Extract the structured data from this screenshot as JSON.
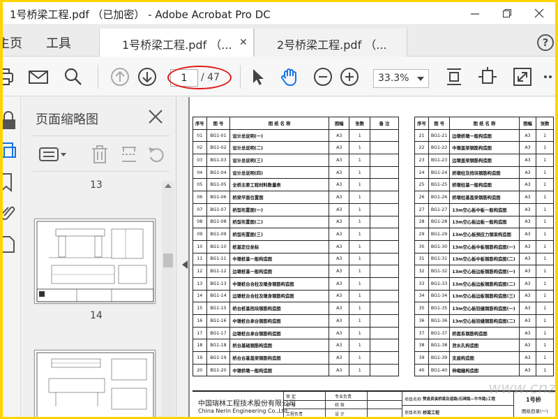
{
  "window": {
    "title": "1号桥梁工程.pdf （已加密） - Adobe Acrobat Pro DC"
  },
  "tabs": {
    "home": "主页",
    "tools": "工具",
    "documents": [
      {
        "label": "1号桥梁工程.pdf （...",
        "active": true
      },
      {
        "label": "2号桥梁工程.pdf （...",
        "active": false
      }
    ],
    "close_glyph": "✕",
    "help": "?"
  },
  "toolbar": {
    "current_page": "1",
    "total_pages": "/ 47",
    "zoom": "33.3%"
  },
  "thumbnail_panel": {
    "title": "页面缩略图",
    "page_numbers": [
      "13",
      "14"
    ]
  },
  "drawing_index": {
    "headers": [
      "序号",
      "图 号",
      "图 纸 名 称",
      "图幅",
      "张数",
      "备 注"
    ],
    "left_rows": [
      [
        "01",
        "BG1-01",
        "设计总说明(一)",
        "A3",
        "1",
        ""
      ],
      [
        "02",
        "BG1-02",
        "设计总说明(二)",
        "A3",
        "1",
        ""
      ],
      [
        "03",
        "BG1-03",
        "设计总说明(三)",
        "A3",
        "1",
        ""
      ],
      [
        "04",
        "BG1-04",
        "设计总说明(四)",
        "A3",
        "1",
        ""
      ],
      [
        "05",
        "BG1-05",
        "全桥主要工程材料数量表",
        "A3",
        "1",
        ""
      ],
      [
        "06",
        "BG1-06",
        "桥梁平面位置图",
        "A3",
        "1",
        ""
      ],
      [
        "07",
        "BG1-07",
        "桥型布置图(一)",
        "A3",
        "1",
        ""
      ],
      [
        "08",
        "BG1-08",
        "桥型布置图(二)",
        "A3",
        "1",
        ""
      ],
      [
        "09",
        "BG1-09",
        "桥型布置图(三)",
        "A3",
        "1",
        ""
      ],
      [
        "10",
        "BG1-10",
        "桩基定位坐标",
        "A3",
        "1",
        ""
      ],
      [
        "11",
        "BG1-11",
        "中墩桩基一般构造图",
        "A3",
        "1",
        ""
      ],
      [
        "12",
        "BG1-12",
        "边墩桩基一般构造图",
        "A3",
        "1",
        ""
      ],
      [
        "13",
        "BG1-13",
        "中墩桩台合柱及墩身钢筋构造图",
        "A3",
        "1",
        ""
      ],
      [
        "14",
        "BG1-14",
        "边墩桩台合柱及墩身钢筋构造图",
        "A3",
        "1",
        ""
      ],
      [
        "15",
        "BG1-15",
        "桥台桩基挡块钢筋构造图",
        "A3",
        "1",
        ""
      ],
      [
        "16",
        "BG1-16",
        "中墩桩台承台钢筋构造图",
        "A3",
        "1",
        ""
      ],
      [
        "17",
        "BG1-17",
        "边墩桩台承台钢筋构造图",
        "A3",
        "1",
        ""
      ],
      [
        "18",
        "BG1-18",
        "桥台基础钢筋构造图",
        "A3",
        "1",
        ""
      ],
      [
        "19",
        "BG1-19",
        "桥台台基盖梁钢筋构造图",
        "A3",
        "1",
        ""
      ],
      [
        "20",
        "BG1-20",
        "中墩桥墩一般构造图",
        "A3",
        "1",
        ""
      ]
    ],
    "right_rows": [
      [
        "21",
        "BG1-21",
        "边墩桥墩一般构造图",
        "A3",
        "1",
        ""
      ],
      [
        "22",
        "BG1-22",
        "中墩盖梁钢筋构造图",
        "A3",
        "1",
        ""
      ],
      [
        "23",
        "BG1-23",
        "边墩盖梁钢筋构造图",
        "A3",
        "1",
        ""
      ],
      [
        "24",
        "BG1-24",
        "桥墩柱及挡块钢筋构造图",
        "A3",
        "1",
        ""
      ],
      [
        "25",
        "BG1-25",
        "桥墩柱基一般构造图",
        "A3",
        "1",
        ""
      ],
      [
        "26",
        "BG1-26",
        "桥墩柱基盖梁钢筋构造图",
        "A3",
        "1",
        ""
      ],
      [
        "27",
        "BG1-27",
        "13m空心板中板一般构造图",
        "A3",
        "1",
        ""
      ],
      [
        "28",
        "BG1-28",
        "13m空心板边板一般构造图",
        "A3",
        "1",
        ""
      ],
      [
        "29",
        "BG1-29",
        "13m空心板预应力钢束构造图",
        "A3",
        "1",
        ""
      ],
      [
        "30",
        "BG1-30",
        "13m空心板中板钢筋构造图(一)",
        "A3",
        "1",
        ""
      ],
      [
        "31",
        "BG1-31",
        "13m空心板中板钢筋构造图(二)",
        "A3",
        "1",
        ""
      ],
      [
        "32",
        "BG1-32",
        "13m空心板边板钢筋构造图(一)",
        "A3",
        "1",
        ""
      ],
      [
        "33",
        "BG1-33",
        "13m空心板边板钢筋构造图(二)",
        "A3",
        "1",
        ""
      ],
      [
        "34",
        "BG1-34",
        "13m空心板边板钢筋构造图(三)",
        "A3",
        "1",
        ""
      ],
      [
        "35",
        "BG1-35",
        "13m空心板铰缝钢筋构造图(一)",
        "A3",
        "1",
        ""
      ],
      [
        "36",
        "BG1-36",
        "13m空心板铰缝钢筋构造图(二)",
        "A3",
        "1",
        ""
      ],
      [
        "37",
        "BG1-37",
        "桥面系钢筋构造图",
        "A3",
        "1",
        ""
      ],
      [
        "38",
        "BG1-38",
        "泄水孔构造图",
        "A3",
        "1",
        ""
      ],
      [
        "39",
        "BG1-39",
        "支座构造图",
        "A3",
        "1",
        ""
      ],
      [
        "40",
        "BG1-40",
        "伸缩缝构造图",
        "A3",
        "1",
        ""
      ]
    ]
  },
  "title_block": {
    "company_cn": "中国瑞林工程技术股份有限公司",
    "company_en": "China Nerin Engineering Co.,Ltd.",
    "approve": "审 定",
    "review": "审 核",
    "lead": "工程负责",
    "specialty": "专业负责",
    "check": "校 核",
    "design": "设 计",
    "project_label": "项目名称",
    "project": "赞县资溪桥梁及道路(石碑路—牛华路)工程",
    "subproject_label": "项目名称",
    "subproject": "桥梁工程",
    "bridge": "1号桥",
    "sheet": "图纸目录(一)"
  },
  "watermark": "www.cnzao.com",
  "colors": {
    "highlight_oval": "#e01818",
    "hand_tool": "#1473e6",
    "frame": "#ffd400"
  }
}
